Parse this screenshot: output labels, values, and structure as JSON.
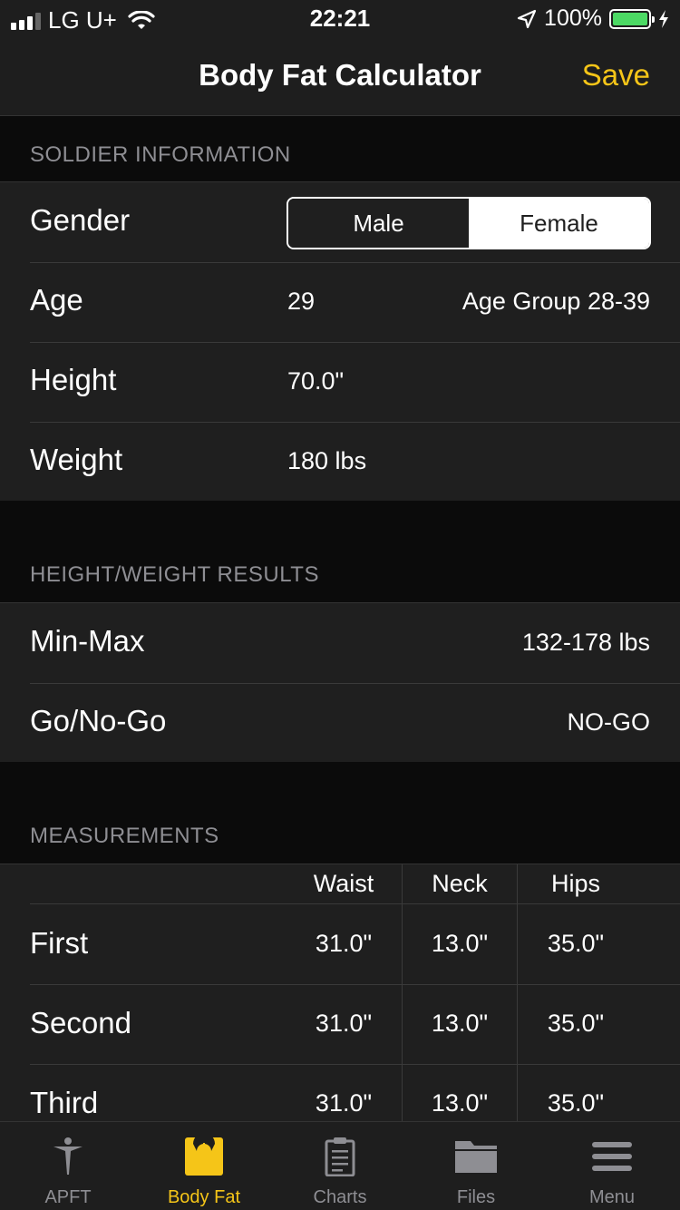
{
  "status_bar": {
    "carrier": "LG U+",
    "time": "22:21",
    "battery": "100%"
  },
  "nav": {
    "title": "Body Fat Calculator",
    "save_label": "Save"
  },
  "soldier_info": {
    "header": "SOLDIER INFORMATION",
    "gender": {
      "label": "Gender",
      "options": [
        "Male",
        "Female"
      ],
      "selected": "Female"
    },
    "age": {
      "label": "Age",
      "value": "29",
      "group": "Age Group 28-39"
    },
    "height": {
      "label": "Height",
      "value": "70.0\""
    },
    "weight": {
      "label": "Weight",
      "value": "180 lbs"
    }
  },
  "hw_results": {
    "header": "HEIGHT/WEIGHT RESULTS",
    "minmax": {
      "label": "Min-Max",
      "value": "132-178 lbs"
    },
    "gonogo": {
      "label": "Go/No-Go",
      "value": "NO-GO"
    }
  },
  "measurements": {
    "header": "MEASUREMENTS",
    "columns": [
      "Waist",
      "Neck",
      "Hips"
    ],
    "rows": [
      {
        "label": "First",
        "values": [
          "31.0\"",
          "13.0\"",
          "35.0\""
        ]
      },
      {
        "label": "Second",
        "values": [
          "31.0\"",
          "13.0\"",
          "35.0\""
        ]
      },
      {
        "label": "Third",
        "values": [
          "31.0\"",
          "13.0\"",
          "35.0\""
        ]
      }
    ]
  },
  "tabs": [
    {
      "label": "APFT",
      "icon": "runner-icon"
    },
    {
      "label": "Body Fat",
      "icon": "scale-icon",
      "active": true
    },
    {
      "label": "Charts",
      "icon": "clipboard-icon"
    },
    {
      "label": "Files",
      "icon": "folder-icon"
    },
    {
      "label": "Menu",
      "icon": "hamburger-icon"
    }
  ],
  "colors": {
    "accent": "#f5c518",
    "battery": "#4cd964",
    "background": "#0b0b0b",
    "cell": "#1f1f1f"
  }
}
